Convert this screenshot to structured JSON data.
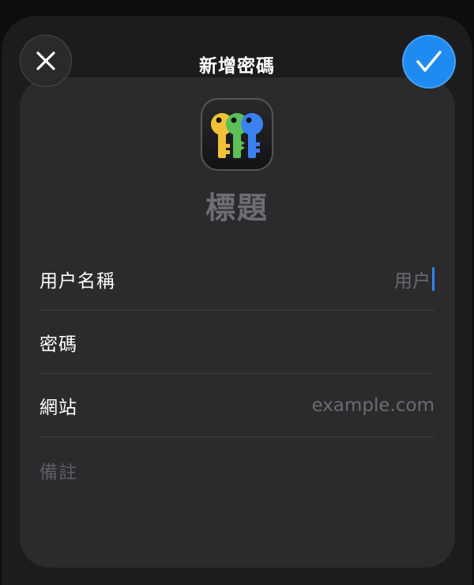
{
  "header": {
    "title": "新增密碼",
    "close_icon": "close-icon",
    "done_icon": "checkmark-icon"
  },
  "item": {
    "app_icon": "keys-icon",
    "title": "標題"
  },
  "fields": [
    {
      "label": "用户名稱",
      "value": "用户"
    },
    {
      "label": "密碼",
      "value": ""
    },
    {
      "label": "網站",
      "placeholder": "example.com"
    }
  ],
  "notes": {
    "placeholder": "備註"
  },
  "colors": {
    "accent": "#1f8bf0",
    "background": "#1c1c1e",
    "card": "#2b2b2d",
    "key_yellow": "#f0c23a",
    "key_green": "#5cbf57",
    "key_blue": "#3b82f0"
  }
}
